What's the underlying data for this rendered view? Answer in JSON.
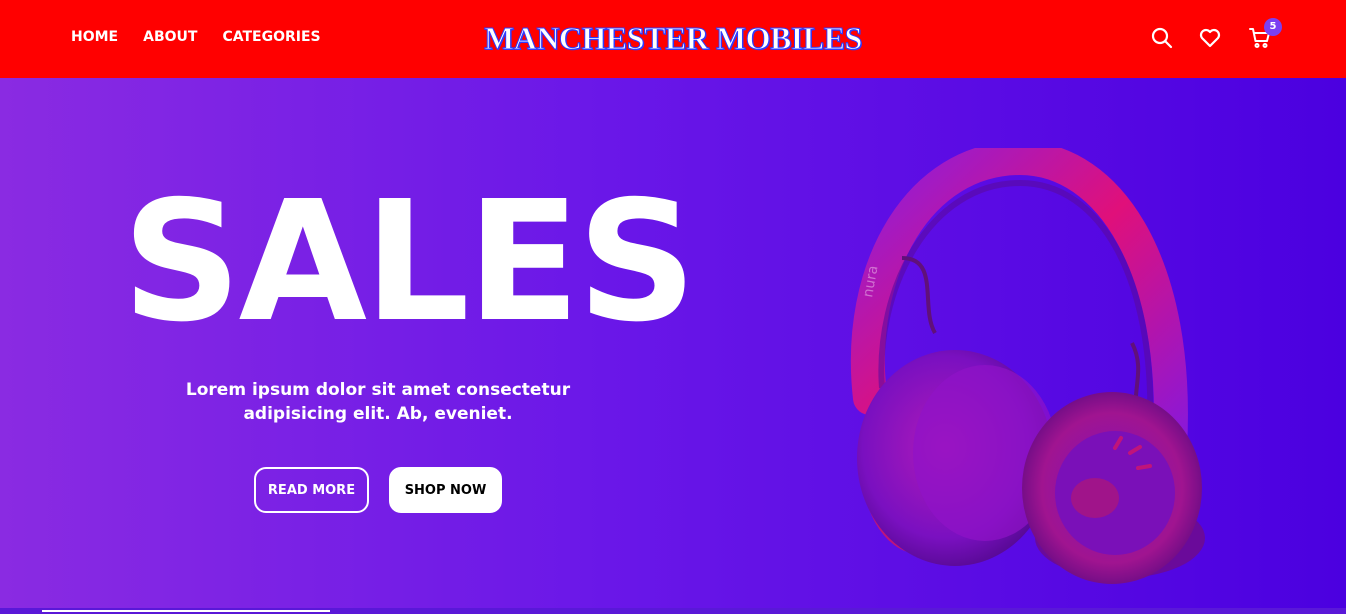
{
  "nav": {
    "links": [
      "HOME",
      "ABOUT",
      "CATEGORIES"
    ],
    "brand": "MANCHESTER MOBILES",
    "icons": [
      "search-icon",
      "heart-icon",
      "cart-icon"
    ],
    "cart_count": "5"
  },
  "hero": {
    "title": "SALES",
    "text": "Lorem ipsum dolor sit amet consectetur adipisicing elit. Ab, eveniet.",
    "buttons": {
      "read_more": "READ MORE",
      "shop_now": "SHOP NOW"
    },
    "image": "headphones",
    "image_logo": "nura"
  },
  "colors": {
    "nav_bg": "#ff0000",
    "hero_start": "#8a2be2",
    "hero_end": "#4b00e0",
    "badge": "#7b3ff2",
    "brand_outline": "#2e3cff"
  }
}
